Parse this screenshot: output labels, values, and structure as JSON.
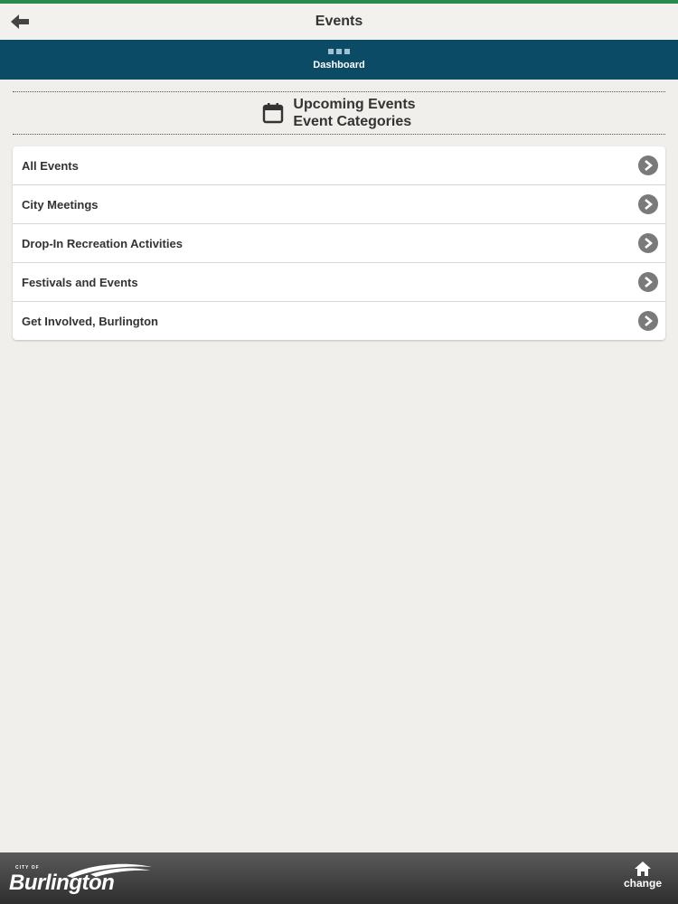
{
  "header": {
    "title": "Events",
    "back_icon": "arrow-left-icon"
  },
  "dashboard": {
    "label": "Dashboard",
    "icon": "dashboard-dots-icon"
  },
  "section": {
    "icon": "calendar-icon",
    "line1": "Upcoming Events",
    "line2": "Event Categories"
  },
  "categories": [
    {
      "label": "All Events"
    },
    {
      "label": "City Meetings"
    },
    {
      "label": "Drop-In Recreation Activities"
    },
    {
      "label": "Festivals and Events"
    },
    {
      "label": "Get Involved, Burlington"
    }
  ],
  "footer": {
    "logo_small": "CITY OF",
    "logo_name": "Burlington",
    "change_label": "change",
    "change_icon": "home-icon"
  },
  "colors": {
    "accent_green": "#2a8a4e",
    "dashboard_bar": "#0b4b66",
    "background": "#f1efec"
  }
}
